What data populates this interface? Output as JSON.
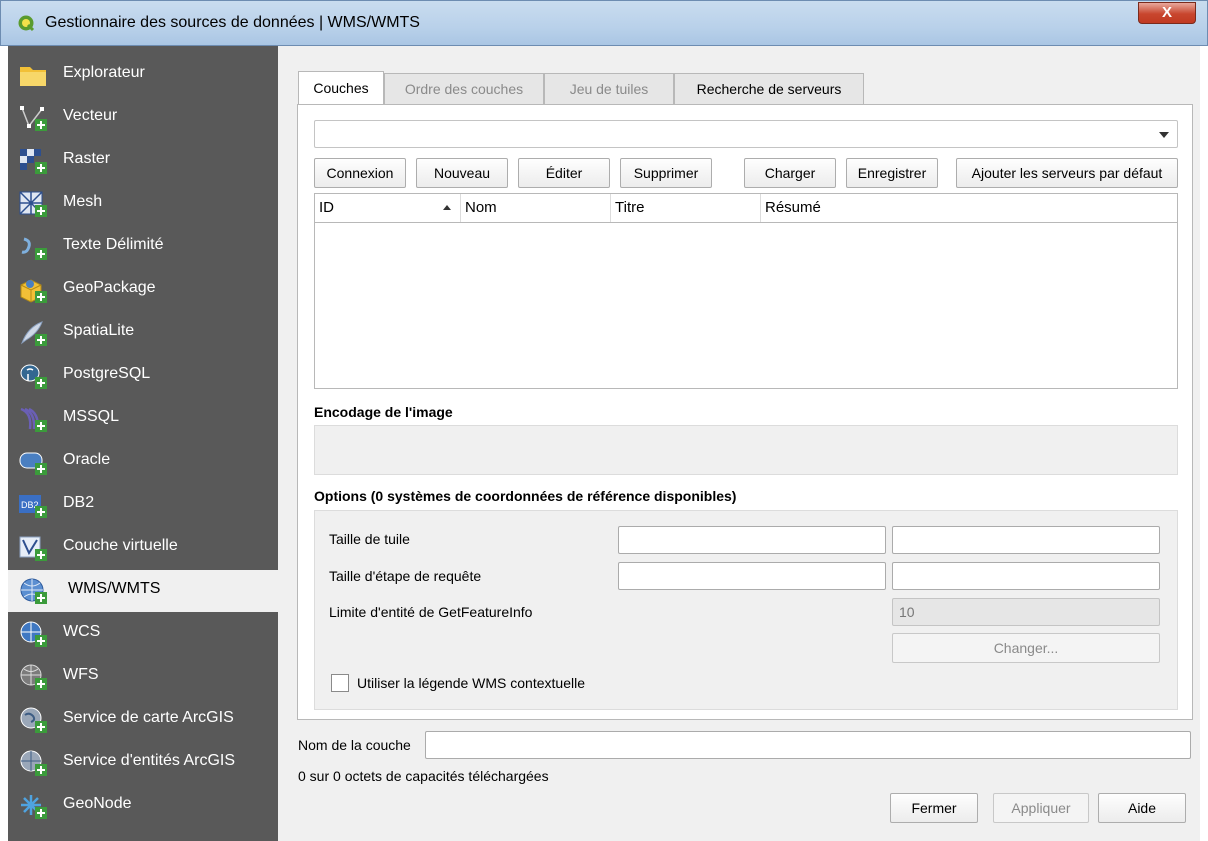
{
  "window": {
    "title": "Gestionnaire des sources de données | WMS/WMTS",
    "close_glyph": "X"
  },
  "sidebar": {
    "items": [
      {
        "label": "Explorateur",
        "icon": "folder-icon"
      },
      {
        "label": "Vecteur",
        "icon": "vector-icon"
      },
      {
        "label": "Raster",
        "icon": "raster-icon"
      },
      {
        "label": "Mesh",
        "icon": "mesh-icon"
      },
      {
        "label": "Texte Délimité",
        "icon": "delimited-text-icon"
      },
      {
        "label": "GeoPackage",
        "icon": "geopackage-icon"
      },
      {
        "label": "SpatiaLite",
        "icon": "spatialite-icon"
      },
      {
        "label": "PostgreSQL",
        "icon": "postgresql-icon"
      },
      {
        "label": "MSSQL",
        "icon": "mssql-icon"
      },
      {
        "label": "Oracle",
        "icon": "oracle-icon"
      },
      {
        "label": "DB2",
        "icon": "db2-icon"
      },
      {
        "label": "Couche virtuelle",
        "icon": "virtual-layer-icon"
      },
      {
        "label": "WMS/WMTS",
        "icon": "wms-icon"
      },
      {
        "label": "WCS",
        "icon": "wcs-icon"
      },
      {
        "label": "WFS",
        "icon": "wfs-icon"
      },
      {
        "label": "Service de carte ArcGIS",
        "icon": "arcgis-map-icon"
      },
      {
        "label": "Service d'entités ArcGIS",
        "icon": "arcgis-feature-icon"
      },
      {
        "label": "GeoNode",
        "icon": "geonode-icon"
      }
    ],
    "active": "WMS/WMTS"
  },
  "tabs": [
    {
      "label": "Couches",
      "state": "active"
    },
    {
      "label": "Ordre des couches",
      "state": "disabled"
    },
    {
      "label": "Jeu de tuiles",
      "state": "disabled"
    },
    {
      "label": "Recherche de serveurs",
      "state": "enabled"
    }
  ],
  "connection_combo": {
    "value": ""
  },
  "buttons": {
    "connect": "Connexion",
    "new": "Nouveau",
    "edit": "Éditer",
    "delete": "Supprimer",
    "load": "Charger",
    "save": "Enregistrer",
    "add_defaults": "Ajouter les serveurs par défaut"
  },
  "table": {
    "columns": [
      "ID",
      "Nom",
      "Titre",
      "Résumé"
    ],
    "rows": []
  },
  "encoding": {
    "title": "Encodage de l'image"
  },
  "options": {
    "title": "Options (0 systèmes de coordonnées de référence disponibles)",
    "tile_size_label": "Taille de tuile",
    "tile_size_w": "",
    "tile_size_h": "",
    "step_size_label": "Taille d'étape de requête",
    "step_size_w": "",
    "step_size_h": "",
    "feature_limit_label": "Limite d'entité de GetFeatureInfo",
    "feature_limit_value": "10",
    "change_button": "Changer...",
    "contextual_legend_label": "Utiliser la légende WMS contextuelle",
    "contextual_legend_checked": false
  },
  "layer_name": {
    "label": "Nom de la couche",
    "value": ""
  },
  "status": "0 sur 0 octets de capacités téléchargées",
  "footer_buttons": {
    "close": "Fermer",
    "apply": "Appliquer",
    "help": "Aide"
  }
}
